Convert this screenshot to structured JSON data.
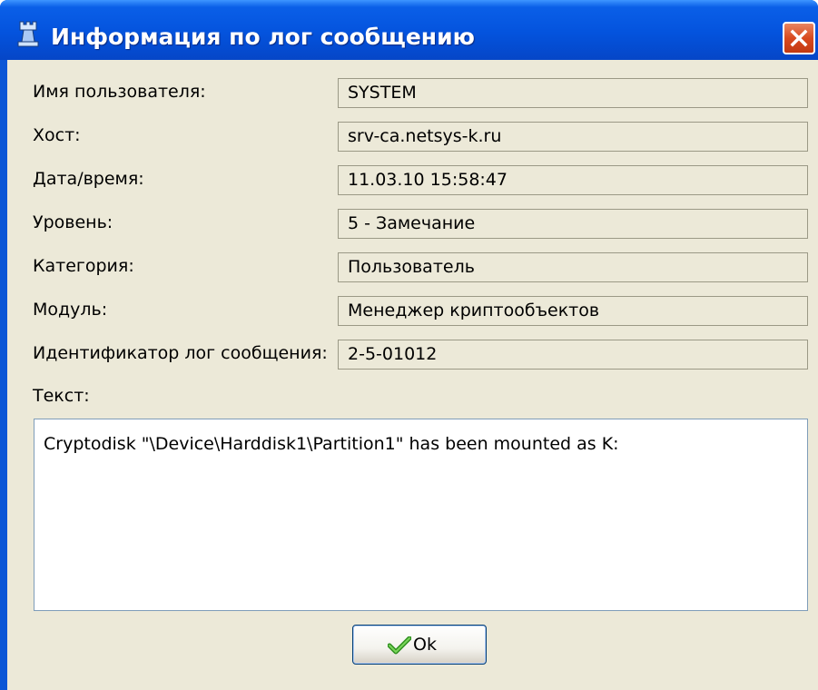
{
  "window": {
    "title": "Информация по лог сообщению",
    "app_icon": "chess-rook-icon",
    "close_icon": "close-icon",
    "colors": {
      "titlebar": "#0453dd",
      "close": "#d94a1f",
      "client": "#ece9d8"
    }
  },
  "fields": [
    {
      "label": "Имя пользователя:",
      "value": "SYSTEM"
    },
    {
      "label": "Хост:",
      "value": "srv-ca.netsys-k.ru"
    },
    {
      "label": "Дата/время:",
      "value": "11.03.10 15:58:47"
    },
    {
      "label": "Уровень:",
      "value": "5 - Замечание"
    },
    {
      "label": "Категория:",
      "value": "Пользователь"
    },
    {
      "label": "Модуль:",
      "value": "Менеджер криптообъектов"
    },
    {
      "label": "Идентификатор лог сообщения:",
      "value": "2-5-01012"
    }
  ],
  "text_section": {
    "label": "Текст:",
    "content": "Cryptodisk \"\\Device\\Harddisk1\\Partition1\" has been mounted as K:"
  },
  "buttons": {
    "ok_label": "Ok",
    "ok_icon": "checkmark-icon"
  }
}
